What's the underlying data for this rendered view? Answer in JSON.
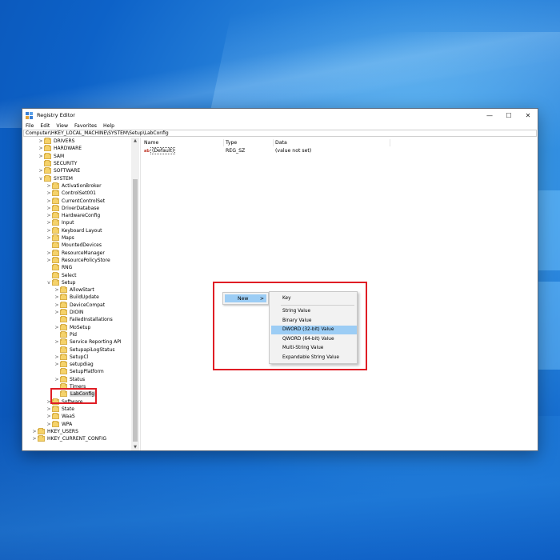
{
  "window": {
    "title": "Registry Editor",
    "controls": {
      "minimize": "—",
      "maximize": "☐",
      "close": "✕"
    }
  },
  "menu": [
    "File",
    "Edit",
    "View",
    "Favorites",
    "Help"
  ],
  "address": "Computer\\HKEY_LOCAL_MACHINE\\SYSTEM\\Setup\\LabConfig",
  "tree": {
    "items": [
      {
        "label": "DRIVERS",
        "level": 1,
        "chevron": ">"
      },
      {
        "label": "HARDWARE",
        "level": 1,
        "chevron": ">"
      },
      {
        "label": "SAM",
        "level": 1,
        "chevron": ">"
      },
      {
        "label": "SECURITY",
        "level": 1,
        "chevron": ""
      },
      {
        "label": "SOFTWARE",
        "level": 1,
        "chevron": ">"
      },
      {
        "label": "SYSTEM",
        "level": 1,
        "chevron": "v"
      },
      {
        "label": "ActivationBroker",
        "level": 2,
        "chevron": ">"
      },
      {
        "label": "ControlSet001",
        "level": 2,
        "chevron": ">"
      },
      {
        "label": "CurrentControlSet",
        "level": 2,
        "chevron": ">"
      },
      {
        "label": "DriverDatabase",
        "level": 2,
        "chevron": ">"
      },
      {
        "label": "HardwareConfig",
        "level": 2,
        "chevron": ">"
      },
      {
        "label": "Input",
        "level": 2,
        "chevron": ">"
      },
      {
        "label": "Keyboard Layout",
        "level": 2,
        "chevron": ">"
      },
      {
        "label": "Maps",
        "level": 2,
        "chevron": ">"
      },
      {
        "label": "MountedDevices",
        "level": 2,
        "chevron": ""
      },
      {
        "label": "ResourceManager",
        "level": 2,
        "chevron": ">"
      },
      {
        "label": "ResourcePolicyStore",
        "level": 2,
        "chevron": ">"
      },
      {
        "label": "RNG",
        "level": 2,
        "chevron": ""
      },
      {
        "label": "Select",
        "level": 2,
        "chevron": ""
      },
      {
        "label": "Setup",
        "level": 2,
        "chevron": "v"
      },
      {
        "label": "AllowStart",
        "level": 3,
        "chevron": ">"
      },
      {
        "label": "BuildUpdate",
        "level": 3,
        "chevron": ">"
      },
      {
        "label": "DeviceCompat",
        "level": 3,
        "chevron": ">"
      },
      {
        "label": "DIOIN",
        "level": 3,
        "chevron": ">"
      },
      {
        "label": "FailedInstallations",
        "level": 3,
        "chevron": ""
      },
      {
        "label": "MoSetup",
        "level": 3,
        "chevron": ">"
      },
      {
        "label": "Pid",
        "level": 3,
        "chevron": ""
      },
      {
        "label": "Service Reporting API",
        "level": 3,
        "chevron": ">"
      },
      {
        "label": "SetupapiLogStatus",
        "level": 3,
        "chevron": ""
      },
      {
        "label": "SetupCl",
        "level": 3,
        "chevron": ">"
      },
      {
        "label": "setupdiag",
        "level": 3,
        "chevron": ">"
      },
      {
        "label": "SetupPlatform",
        "level": 3,
        "chevron": ""
      },
      {
        "label": "Status",
        "level": 3,
        "chevron": ">"
      },
      {
        "label": "Timers",
        "level": 3,
        "chevron": ""
      },
      {
        "label": "LabConfig",
        "level": 3,
        "chevron": "",
        "selected": true
      },
      {
        "label": "Software",
        "level": 2,
        "chevron": ">"
      },
      {
        "label": "State",
        "level": 2,
        "chevron": ">"
      },
      {
        "label": "WaaS",
        "level": 2,
        "chevron": ">"
      },
      {
        "label": "WPA",
        "level": 2,
        "chevron": ">"
      },
      {
        "label": "HKEY_USERS",
        "level": 0,
        "chevron": ">"
      },
      {
        "label": "HKEY_CURRENT_CONFIG",
        "level": 0,
        "chevron": ">"
      }
    ]
  },
  "list": {
    "columns": {
      "name": "Name",
      "type": "Type",
      "data": "Data"
    },
    "rows": [
      {
        "icon": "ab",
        "name": "(Default)",
        "type": "REG_SZ",
        "data": "(value not set)"
      }
    ]
  },
  "context_menu": {
    "new_label": "New",
    "new_arrow": ">",
    "submenu": [
      {
        "label": "Key"
      },
      {
        "label": "String Value"
      },
      {
        "label": "Binary Value"
      },
      {
        "label": "DWORD (32-bit) Value",
        "highlighted": true
      },
      {
        "label": "QWORD (64-bit) Value"
      },
      {
        "label": "Multi-String Value"
      },
      {
        "label": "Expandable String Value"
      }
    ]
  },
  "colors": {
    "highlight_outline": "#e01d25",
    "menu_highlight": "#9ccdf5",
    "folder": "#f5d26a"
  }
}
